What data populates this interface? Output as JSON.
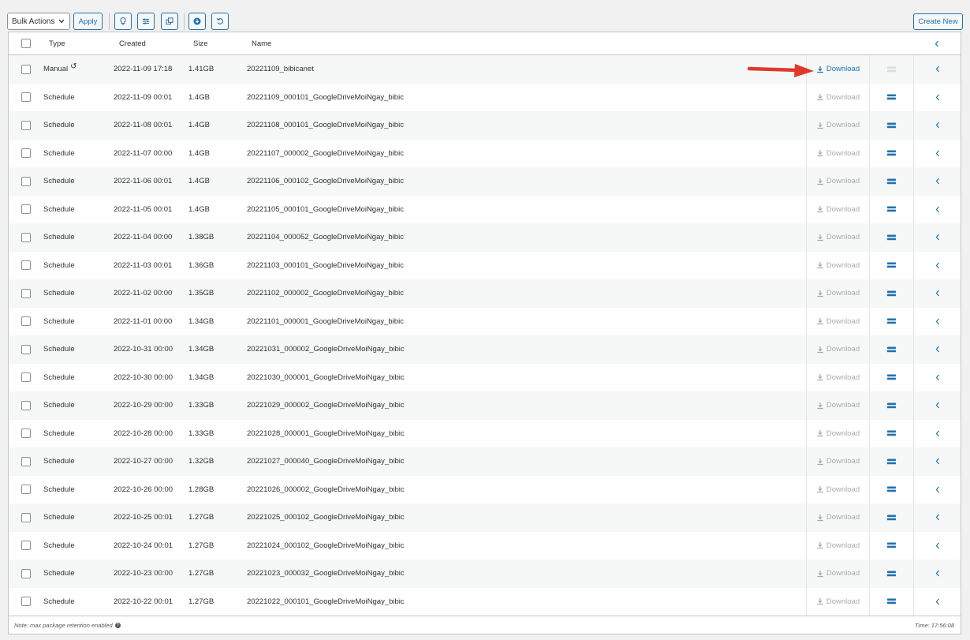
{
  "toolbar": {
    "bulk_actions_label": "Bulk Actions",
    "apply_label": "Apply",
    "create_new_label": "Create New",
    "icons": [
      "lightbulb-icon",
      "sliders-icon",
      "copy-icon",
      "download-circle-icon",
      "undo-icon"
    ]
  },
  "table": {
    "columns": {
      "type": "Type",
      "created": "Created",
      "size": "Size",
      "name": "Name"
    },
    "download_label": "Download",
    "rows": [
      {
        "type": "Manual",
        "created": "2022-11-09 17:18",
        "size": "1.41GB",
        "name": "20221109_bibicanet",
        "highlighted": true
      },
      {
        "type": "Schedule",
        "created": "2022-11-09 00:01",
        "size": "1.4GB",
        "name": "20221109_000101_GoogleDriveMoiNgay_bibic"
      },
      {
        "type": "Schedule",
        "created": "2022-11-08 00:01",
        "size": "1.4GB",
        "name": "20221108_000101_GoogleDriveMoiNgay_bibic"
      },
      {
        "type": "Schedule",
        "created": "2022-11-07 00:00",
        "size": "1.4GB",
        "name": "20221107_000002_GoogleDriveMoiNgay_bibic"
      },
      {
        "type": "Schedule",
        "created": "2022-11-06 00:01",
        "size": "1.4GB",
        "name": "20221106_000102_GoogleDriveMoiNgay_bibic"
      },
      {
        "type": "Schedule",
        "created": "2022-11-05 00:01",
        "size": "1.4GB",
        "name": "20221105_000101_GoogleDriveMoiNgay_bibic"
      },
      {
        "type": "Schedule",
        "created": "2022-11-04 00:00",
        "size": "1.38GB",
        "name": "20221104_000052_GoogleDriveMoiNgay_bibic"
      },
      {
        "type": "Schedule",
        "created": "2022-11-03 00:01",
        "size": "1.36GB",
        "name": "20221103_000101_GoogleDriveMoiNgay_bibic"
      },
      {
        "type": "Schedule",
        "created": "2022-11-02 00:00",
        "size": "1.35GB",
        "name": "20221102_000002_GoogleDriveMoiNgay_bibic"
      },
      {
        "type": "Schedule",
        "created": "2022-11-01 00:00",
        "size": "1.34GB",
        "name": "20221101_000001_GoogleDriveMoiNgay_bibic"
      },
      {
        "type": "Schedule",
        "created": "2022-10-31 00:00",
        "size": "1.34GB",
        "name": "20221031_000002_GoogleDriveMoiNgay_bibic"
      },
      {
        "type": "Schedule",
        "created": "2022-10-30 00:00",
        "size": "1.34GB",
        "name": "20221030_000001_GoogleDriveMoiNgay_bibic"
      },
      {
        "type": "Schedule",
        "created": "2022-10-29 00:00",
        "size": "1.33GB",
        "name": "20221029_000002_GoogleDriveMoiNgay_bibic"
      },
      {
        "type": "Schedule",
        "created": "2022-10-28 00:00",
        "size": "1.33GB",
        "name": "20221028_000001_GoogleDriveMoiNgay_bibic"
      },
      {
        "type": "Schedule",
        "created": "2022-10-27 00:00",
        "size": "1.32GB",
        "name": "20221027_000040_GoogleDriveMoiNgay_bibic"
      },
      {
        "type": "Schedule",
        "created": "2022-10-26 00:00",
        "size": "1.28GB",
        "name": "20221026_000002_GoogleDriveMoiNgay_bibic"
      },
      {
        "type": "Schedule",
        "created": "2022-10-25 00:01",
        "size": "1.27GB",
        "name": "20221025_000102_GoogleDriveMoiNgay_bibic"
      },
      {
        "type": "Schedule",
        "created": "2022-10-24 00:01",
        "size": "1.27GB",
        "name": "20221024_000102_GoogleDriveMoiNgay_bibic"
      },
      {
        "type": "Schedule",
        "created": "2022-10-23 00:00",
        "size": "1.27GB",
        "name": "20221023_000032_GoogleDriveMoiNgay_bibic"
      },
      {
        "type": "Schedule",
        "created": "2022-10-22 00:01",
        "size": "1.27GB",
        "name": "20221022_000101_GoogleDriveMoiNgay_bibic"
      }
    ]
  },
  "footer": {
    "note": "Note: max package retention enabled",
    "time": "Time: 17:56:08"
  },
  "colors": {
    "accent": "#2271b1",
    "disabled": "#a7aaad",
    "annotation_arrow": "#e0392b"
  }
}
